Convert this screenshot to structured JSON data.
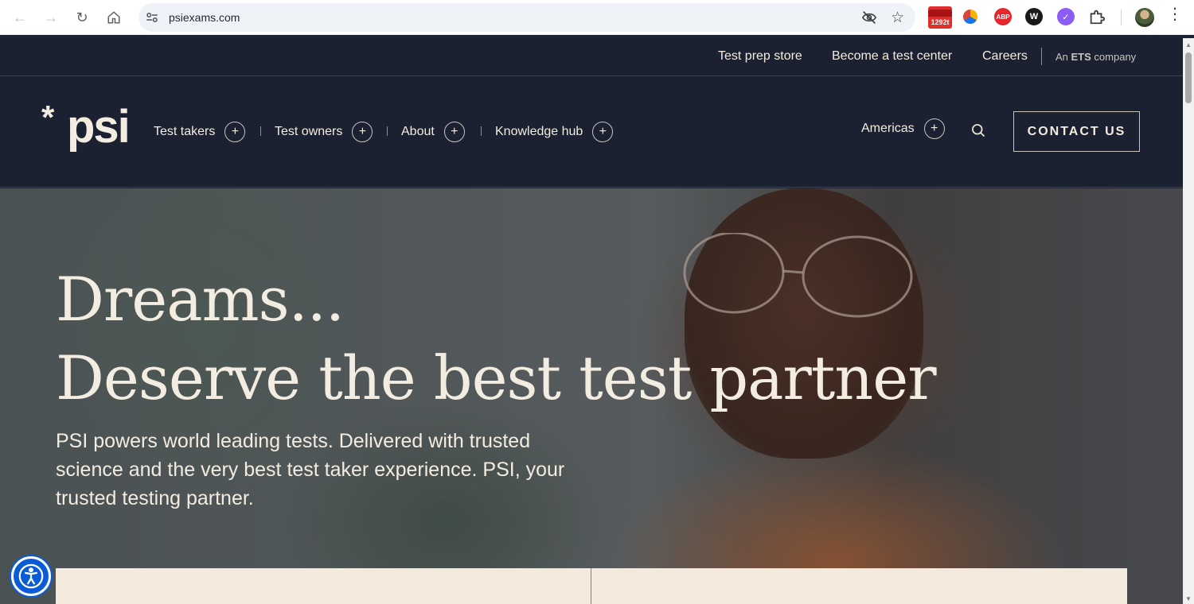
{
  "browser": {
    "url": "psiexams.com",
    "calendar_badge": "1292t",
    "abp_label": "ABP",
    "w_label": "W",
    "v_label": "✓"
  },
  "topbar": {
    "links": [
      "Test prep store",
      "Become a test center",
      "Careers"
    ],
    "ets_prefix": "An ",
    "ets_bold": "ETS",
    "ets_suffix": " company"
  },
  "nav": {
    "logo_star": "*",
    "logo_word": "psi",
    "items": [
      "Test takers",
      "Test owners",
      "About",
      "Knowledge hub"
    ],
    "region": "Americas",
    "plus": "+",
    "contact": "CONTACT US"
  },
  "hero": {
    "line1": "Dreams...",
    "line2": "Deserve  the best test partner",
    "subtitle": "PSI powers world leading tests. Delivered with trusted science and the very best test taker experience. PSI, your trusted testing partner."
  },
  "colors": {
    "navy": "#1b2130",
    "cream": "#f3ece0",
    "card": "#f3e9dc",
    "accessibility_blue": "#0a5bd6"
  }
}
